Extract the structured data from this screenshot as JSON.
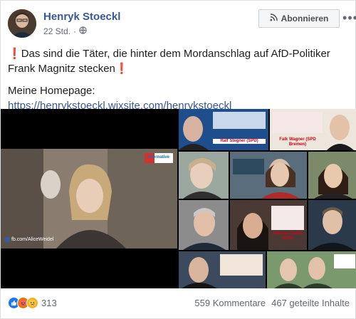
{
  "header": {
    "author": "Henryk Stoeckl",
    "time": "22 Std.",
    "follow_label": "Abonnieren",
    "more_label": "•••"
  },
  "post": {
    "line1_excl": "❗",
    "line1_text": "Das sind die Täter, die hinter dem Mordanschlag auf AfD-Politiker Frank Magnitz stecken",
    "line1_excl_end": "❗",
    "homepage_label": "Meine Homepage:",
    "homepage_link": "https://henrykstoeckl.wixsite.com/henrykstoeckl"
  },
  "media": {
    "video_watermark": "fb.com/AliceWeidel",
    "video_logo": "Alternative",
    "tiles": [
      {
        "caption": "Ralf Stegner (SPD)"
      },
      {
        "caption": "Falk Wagner (SPD Bremen)"
      },
      {
        "caption": ""
      },
      {
        "caption": ""
      },
      {
        "caption": ""
      },
      {
        "caption": ""
      },
      {
        "caption": "Sawsan Chebli (SPD)"
      },
      {
        "caption": ""
      },
      {
        "caption": ""
      },
      {
        "caption": ""
      }
    ]
  },
  "footer": {
    "reaction_count": "313",
    "comments": "559 Kommentare",
    "shares": "467 geteilte Inhalte"
  },
  "colors": {
    "link": "#385898",
    "secondary": "#606770",
    "exclamation": "#d0021b"
  },
  "icons": [
    "globe-icon",
    "rss-icon",
    "more-icon",
    "like-icon",
    "angry-icon",
    "sad-icon"
  ]
}
